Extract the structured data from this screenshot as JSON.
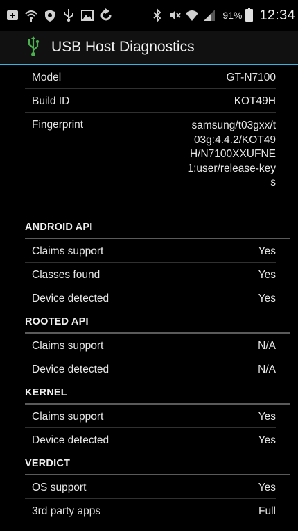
{
  "status_bar": {
    "left_icons": [
      "add-icon",
      "wifi-icon",
      "shield-icon",
      "usb-icon",
      "image-icon",
      "refresh-icon"
    ],
    "right_icons": [
      "bluetooth-icon",
      "mute-icon",
      "wifi-icon",
      "signal-icon",
      "battery-icon"
    ],
    "battery": "91%",
    "battery_level": 0.91,
    "time": "12:34"
  },
  "action_bar": {
    "title": "USB Host Diagnostics",
    "icon": "usb-icon",
    "accent_color": "#33b5e5"
  },
  "device_info": [
    {
      "label": "Model",
      "value": "GT-N7100"
    },
    {
      "label": "Build ID",
      "value": "KOT49H"
    },
    {
      "label": "Fingerprint",
      "value": "samsung/t03gxx/t03g:4.4.2/KOT49H/N7100XXUFNE1:user/release-keys"
    }
  ],
  "sections": [
    {
      "title": "ANDROID API",
      "rows": [
        {
          "label": "Claims support",
          "value": "Yes"
        },
        {
          "label": "Classes found",
          "value": "Yes"
        },
        {
          "label": "Device detected",
          "value": "Yes"
        }
      ]
    },
    {
      "title": "ROOTED API",
      "rows": [
        {
          "label": "Claims support",
          "value": "N/A"
        },
        {
          "label": "Device detected",
          "value": "N/A"
        }
      ]
    },
    {
      "title": "KERNEL",
      "rows": [
        {
          "label": "Claims support",
          "value": "Yes"
        },
        {
          "label": "Device detected",
          "value": "Yes"
        }
      ]
    },
    {
      "title": "VERDICT",
      "rows": [
        {
          "label": "OS support",
          "value": "Yes"
        },
        {
          "label": "3rd party apps",
          "value": "Full"
        }
      ]
    }
  ]
}
